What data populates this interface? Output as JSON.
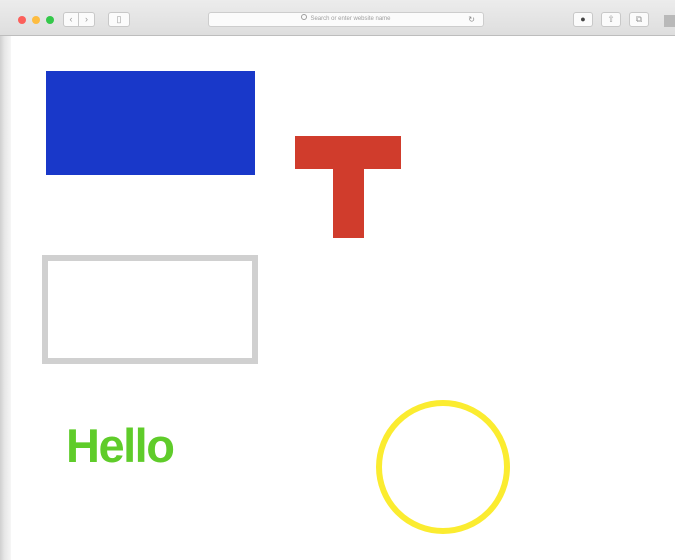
{
  "toolbar": {
    "back_glyph": "‹",
    "forward_glyph": "›",
    "sidebar_glyph": "▯",
    "address_placeholder": "Search or enter website name",
    "reload_glyph": "↻",
    "download_glyph": "●",
    "share_glyph": "⇧",
    "tabs_glyph": "⧉"
  },
  "colors": {
    "close": "#fc605b",
    "minimize": "#fdbc40",
    "maximize": "#34c84a",
    "blue_rect": "#1938c9",
    "t_shape": "#d03c2c",
    "grey_outline": "#d0d0d0",
    "hello": "#5fcc2a",
    "yellow_circle": "#fbec30"
  },
  "canvas": {
    "hello_text": "Hello"
  }
}
